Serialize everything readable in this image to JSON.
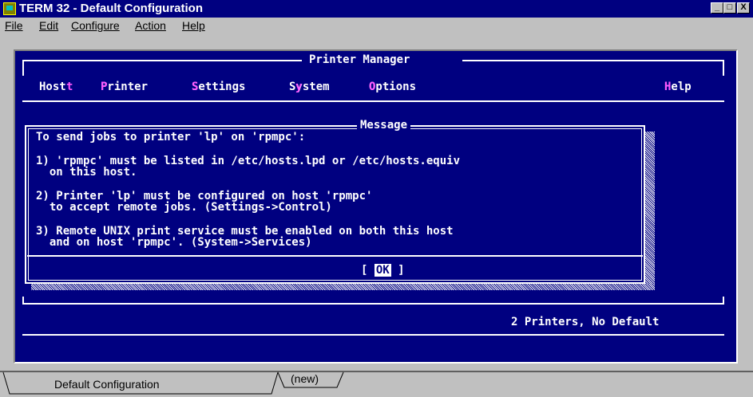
{
  "window": {
    "title": "TERM 32 - Default Configuration",
    "minimize_glyph": "_",
    "maximize_glyph": "□",
    "close_glyph": "X"
  },
  "menubar": {
    "file": "File",
    "edit": "Edit",
    "configure": "Configure",
    "action": "Action",
    "help": "Help"
  },
  "terminal": {
    "panel_title": "Printer Manager",
    "menu": {
      "host": "Host",
      "printer": "Printer",
      "settings": "Settings",
      "system": "System",
      "options": "Options",
      "help": "Help"
    },
    "dialog": {
      "title": "Message",
      "lines": [
        "To send jobs to printer 'lp' on 'rpmpc':",
        "1) 'rpmpc' must be listed in /etc/hosts.lpd or /etc/hosts.equiv",
        "  on this host.",
        "2) Printer 'lp' must be configured on host 'rpmpc'",
        "  to accept remote jobs. (Settings->Control)",
        "3) Remote UNIX print service must be enabled on both this host",
        "  and on host 'rpmpc'. (System->Services)"
      ],
      "ok_label": "OK"
    },
    "status": "2 Printers, No Default"
  },
  "tabs": {
    "active": "Default Configuration",
    "new": "(new)"
  },
  "colors": {
    "terminal_bg": "#000080",
    "hotkey": "#ff55ff",
    "titlebar": "#000080"
  }
}
